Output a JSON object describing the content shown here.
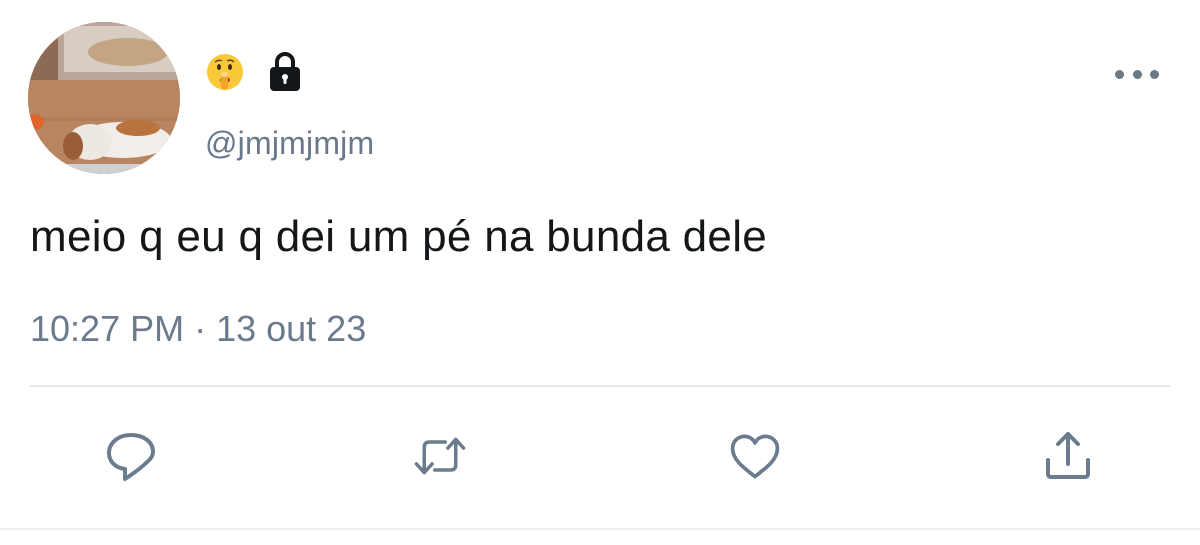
{
  "tweet": {
    "handle": "@jmjmjmjm",
    "name_icons": [
      "shushing-face-emoji-icon",
      "lock-icon"
    ],
    "text": "meio q eu q dei um pé na bunda dele",
    "time": "10:27 PM",
    "separator": "·",
    "date": "13 out 23"
  },
  "actions": [
    "reply-icon",
    "retweet-icon",
    "like-icon",
    "share-icon"
  ],
  "colors": {
    "text": "#14171a",
    "secondary": "#6b7a8c",
    "icon": "#6a7c8d",
    "divider": "#e5e9ec"
  }
}
